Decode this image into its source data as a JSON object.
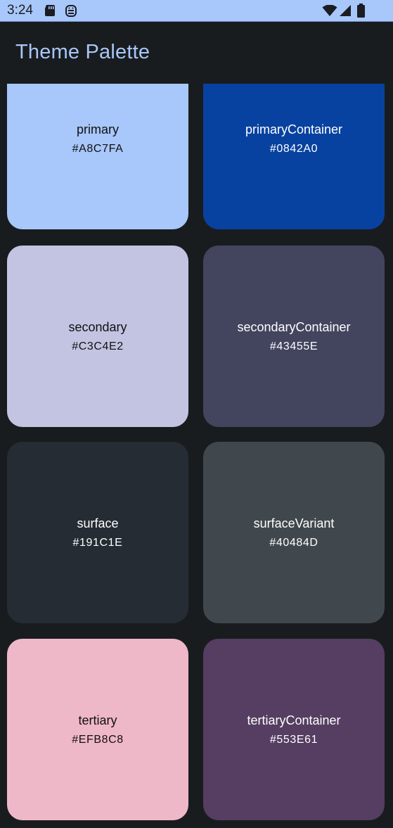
{
  "status_bar": {
    "time": "3:24",
    "icons": [
      "sd-card-icon",
      "android-debug-icon",
      "wifi-icon",
      "signal-icon",
      "battery-icon"
    ]
  },
  "app_bar": {
    "title": "Theme Palette"
  },
  "colors": {
    "status_bar_bg": "#A8C7FA",
    "page_bg": "#191C1E",
    "title_color": "#A8C7FA"
  },
  "tiles": [
    {
      "name": "primary",
      "hex": "#A8C7FA",
      "bg": "#A8C7FA",
      "fg": "#111111"
    },
    {
      "name": "primaryContainer",
      "hex": "#0842A0",
      "bg": "#0842A0",
      "fg": "#FFFFFF"
    },
    {
      "name": "secondary",
      "hex": "#C3C4E2",
      "bg": "#C3C4E2",
      "fg": "#111111"
    },
    {
      "name": "secondaryContainer",
      "hex": "#43455E",
      "bg": "#43455E",
      "fg": "#FFFFFF"
    },
    {
      "name": "surface",
      "hex": "#191C1E",
      "bg": "#252C33",
      "fg": "#FFFFFF"
    },
    {
      "name": "surfaceVariant",
      "hex": "#40484D",
      "bg": "#40484D",
      "fg": "#FFFFFF"
    },
    {
      "name": "tertiary",
      "hex": "#EFB8C8",
      "bg": "#EFB8C8",
      "fg": "#111111"
    },
    {
      "name": "tertiaryContainer",
      "hex": "#553E61",
      "bg": "#553E61",
      "fg": "#FFFFFF"
    }
  ]
}
